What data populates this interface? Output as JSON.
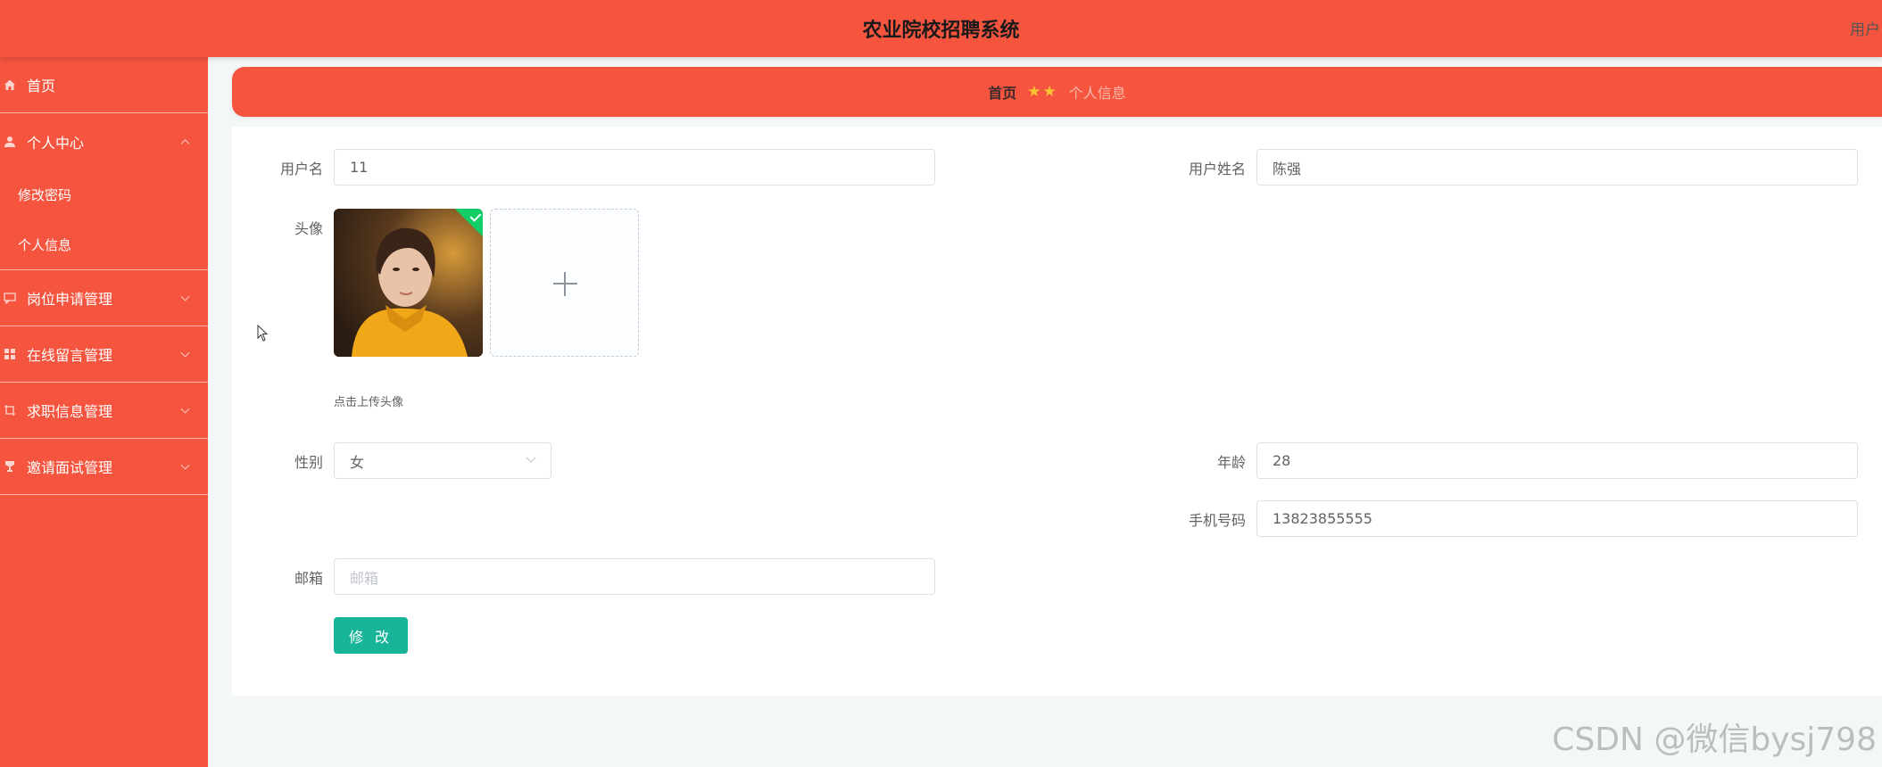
{
  "header": {
    "title": "农业院校招聘系统",
    "user_label": "用户"
  },
  "sidebar": {
    "items": [
      {
        "label": "首页",
        "icon": "home-icon"
      },
      {
        "label": "个人中心",
        "icon": "user-icon",
        "expanded": true,
        "children": [
          {
            "label": "修改密码"
          },
          {
            "label": "个人信息"
          }
        ]
      },
      {
        "label": "岗位申请管理",
        "icon": "message-icon"
      },
      {
        "label": "在线留言管理",
        "icon": "grid-icon"
      },
      {
        "label": "求职信息管理",
        "icon": "crop-icon"
      },
      {
        "label": "邀请面试管理",
        "icon": "trophy-icon"
      }
    ]
  },
  "breadcrumb": {
    "home": "首页",
    "current": "个人信息",
    "separator_icon": "star-icon"
  },
  "form": {
    "username": {
      "label": "用户名",
      "value": "11"
    },
    "realname": {
      "label": "用户姓名",
      "value": "陈强"
    },
    "avatar": {
      "label": "头像",
      "hint": "点击上传头像"
    },
    "gender": {
      "label": "性别",
      "value": "女"
    },
    "age": {
      "label": "年龄",
      "value": "28"
    },
    "phone": {
      "label": "手机号码",
      "value": "13823855555"
    },
    "email": {
      "label": "邮箱",
      "value": "",
      "placeholder": "邮箱"
    },
    "submit_label": "修 改"
  },
  "watermark": "CSDN @微信bysj798",
  "colors": {
    "primary": "#f5543e",
    "button": "#17b49a",
    "star": "#f6c532",
    "success_badge": "#13ce66"
  }
}
